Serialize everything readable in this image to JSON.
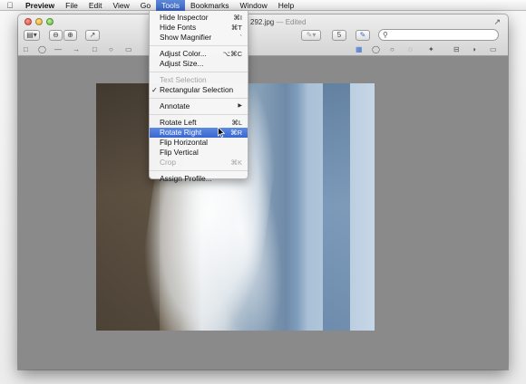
{
  "menubar": {
    "apple_icon": "apple-icon",
    "items": [
      "Preview",
      "File",
      "Edit",
      "View",
      "Go",
      "Tools",
      "Bookmarks",
      "Window",
      "Help"
    ],
    "open_menu": "Tools"
  },
  "window": {
    "title": "292.jpg",
    "title_status": "— Edited",
    "rotate_badge": "5"
  },
  "tools_menu": {
    "hide_inspector": {
      "label": "Hide Inspector",
      "shortcut": "⌘I"
    },
    "hide_fonts": {
      "label": "Hide Fonts",
      "shortcut": "⌘T"
    },
    "show_magnifier": {
      "label": "Show Magnifier",
      "shortcut": "`"
    },
    "adjust_color": {
      "label": "Adjust Color...",
      "shortcut": "⌥⌘C"
    },
    "adjust_size": {
      "label": "Adjust Size..."
    },
    "text_selection": {
      "label": "Text Selection"
    },
    "rect_selection": {
      "label": "Rectangular Selection"
    },
    "annotate": {
      "label": "Annotate"
    },
    "rotate_left": {
      "label": "Rotate Left",
      "shortcut": "⌘L"
    },
    "rotate_right": {
      "label": "Rotate Right",
      "shortcut": "⌘R"
    },
    "flip_horizontal": {
      "label": "Flip Horizontal"
    },
    "flip_vertical": {
      "label": "Flip Vertical"
    },
    "crop": {
      "label": "Crop",
      "shortcut": "⌘K"
    },
    "assign_profile": {
      "label": "Assign Profile..."
    }
  },
  "colors": {
    "menu_highlight": "#3c66c4",
    "window_background": "#8a8a8a"
  }
}
